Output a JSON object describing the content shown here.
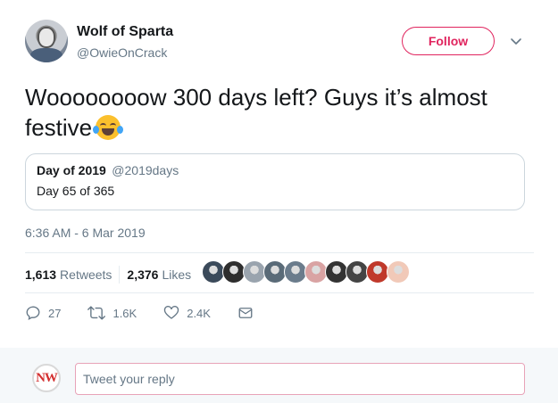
{
  "author": {
    "name": "Wolf of Sparta",
    "handle": "@OwieOnCrack"
  },
  "follow_label": "Follow",
  "tweet_text": "Woooooooow 300 days left? Guys it’s almost festive",
  "tweet_emoji": "face-with-tears-of-joy",
  "quoted": {
    "name": "Day of 2019",
    "handle": "@2019days",
    "text": "Day 65 of 365"
  },
  "timestamp": "6:36 AM - 6 Mar 2019",
  "stats": {
    "retweets_count": "1,613",
    "retweets_label": "Retweets",
    "likes_count": "2,376",
    "likes_label": "Likes"
  },
  "liker_colors": [
    "#3b4a5a",
    "#2e2e2e",
    "#9aa4ae",
    "#5a6b78",
    "#6b7c8c",
    "#d9a3a3",
    "#333333",
    "#444444",
    "#c0392b",
    "#f1c9b8"
  ],
  "actions": {
    "replies": "27",
    "retweets": "1.6K",
    "likes": "2.4K"
  },
  "reply": {
    "placeholder": "Tweet your reply",
    "avatar_text": "NW"
  },
  "colors": {
    "accent": "#e0245e",
    "muted": "#657786"
  }
}
